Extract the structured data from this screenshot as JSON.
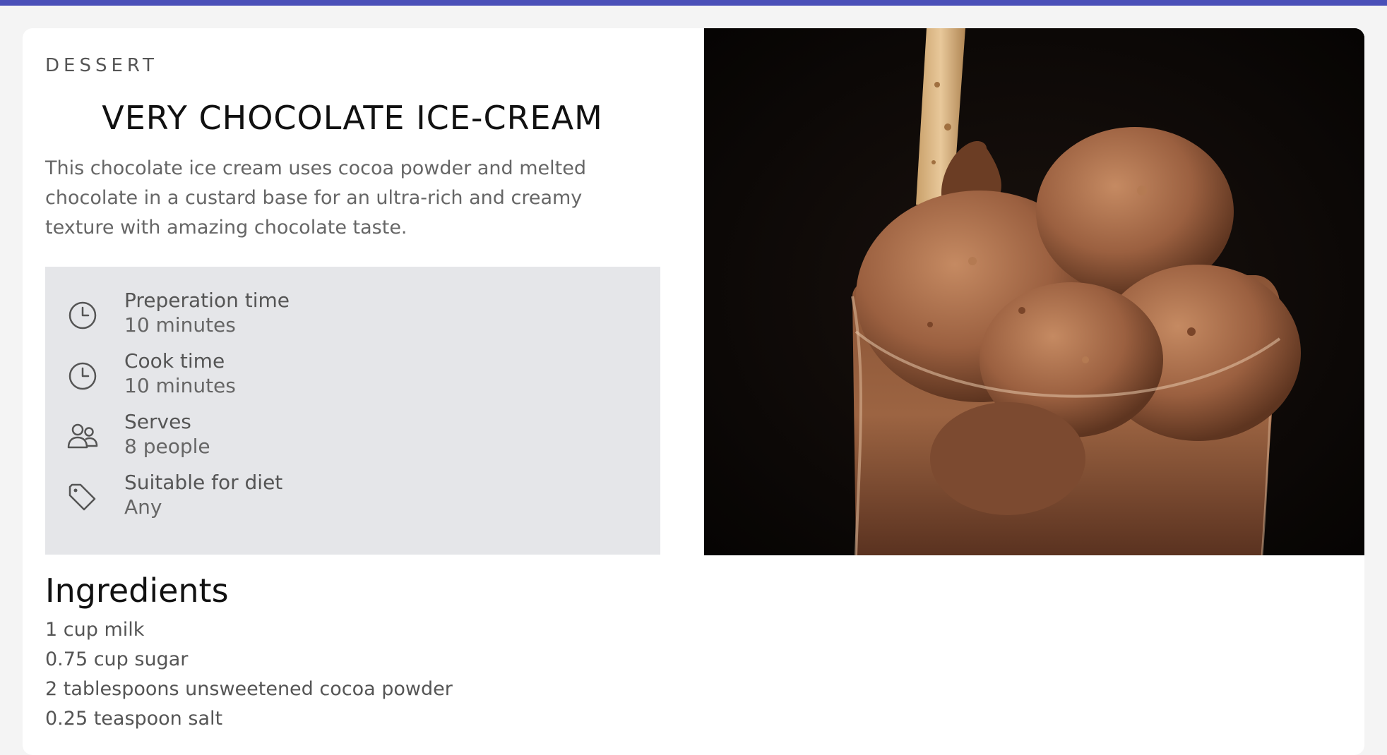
{
  "category": "DESSERT",
  "title": "VERY CHOCOLATE ICE-CREAM",
  "description": "This chocolate ice cream uses cocoa powder and melted chocolate in a custard base for an ultra-rich and creamy texture with amazing chocolate taste.",
  "info": [
    {
      "icon": "clock-icon",
      "label": "Preperation time",
      "value": "10 minutes"
    },
    {
      "icon": "clock-icon",
      "label": "Cook time",
      "value": "10 minutes"
    },
    {
      "icon": "people-icon",
      "label": "Serves",
      "value": "8 people"
    },
    {
      "icon": "tag-icon",
      "label": "Suitable for diet",
      "value": "Any"
    }
  ],
  "ingredients": {
    "heading": "Ingredients",
    "items": [
      "1 cup milk",
      "0.75 cup sugar",
      "2 tablespoons unsweetened cocoa powder",
      "0.25 teaspoon salt"
    ]
  },
  "colors": {
    "accent_bar": "#4a50b8",
    "panel_bg": "#e5e6e9",
    "page_bg": "#f4f4f4"
  }
}
